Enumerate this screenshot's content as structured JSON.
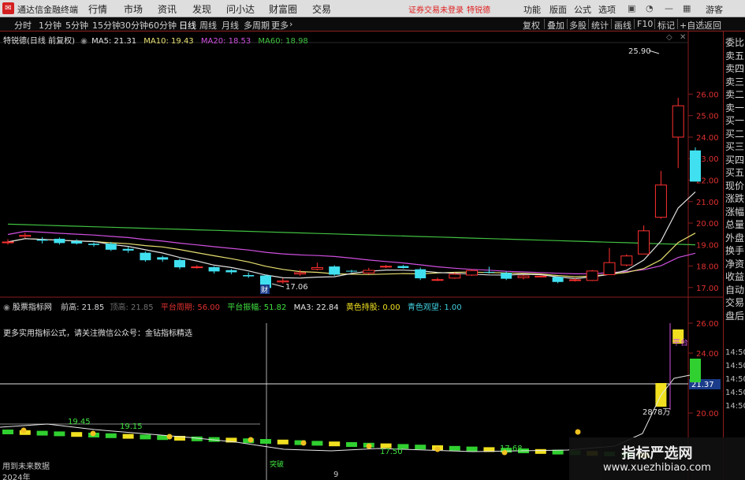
{
  "app": {
    "title": "通达信金融终端"
  },
  "menu": [
    "行情",
    "市场",
    "资讯",
    "发现",
    "问小达",
    "财富圈",
    "交易"
  ],
  "login_warning": "证券交易未登录",
  "stock_link": "特锐德",
  "menu_right": [
    "功能",
    "版面",
    "公式",
    "选项"
  ],
  "guest": "游客",
  "periods": [
    "分时",
    "1分钟",
    "5分钟",
    "15分钟",
    "30分钟",
    "60分钟",
    "日线",
    "周线",
    "月线",
    "多周期",
    "更多"
  ],
  "active_period": "日线",
  "toolbar": [
    "复权",
    "叠加",
    "多股",
    "统计",
    "画线",
    "F10",
    "标记",
    "+自选",
    "返回"
  ],
  "main": {
    "header": "特锐德(日线 前复权)",
    "ma": [
      {
        "label": "MA5: 21.31",
        "color": "#e0e0e0"
      },
      {
        "label": "MA10: 19.43",
        "color": "#e8e070"
      },
      {
        "label": "MA20: 18.53",
        "color": "#d050e0"
      },
      {
        "label": "MA60: 18.98",
        "color": "#40c040"
      }
    ],
    "high_label": "25.90",
    "low_label": "17.06",
    "event_label": "财",
    "price_axis": [
      "26.00",
      "25.00",
      "24.00",
      "23.00",
      "22.00",
      "21.00",
      "20.00",
      "19.00",
      "18.00",
      "17.00"
    ]
  },
  "sub": {
    "header_name": "股票指标网",
    "values": [
      {
        "label": "前高: 21.85",
        "color": "#d8d8d8"
      },
      {
        "label": "顶高: 21.85",
        "color": "#707070"
      },
      {
        "label": "平台周期: 56.00",
        "color": "#e03030"
      },
      {
        "label": "平台振幅: 51.82",
        "color": "#40e040"
      },
      {
        "label": "MA3: 22.84",
        "color": "#e8e8e8"
      },
      {
        "label": "黄色持股: 0.00",
        "color": "#f0e020"
      },
      {
        "label": "青色观望: 1.00",
        "color": "#40d0e0"
      }
    ],
    "promo": "更多实用指标公式，请关注微信公众号：金钻指标精选",
    "axis": [
      "26.00",
      "24.00",
      "21.37",
      "20.00"
    ],
    "ref_value": "21.37",
    "labels": [
      "19.45",
      "19.15",
      "17.50",
      "17.68",
      "2878万",
      "平台",
      "突破"
    ],
    "footer_left": "用到未来数据",
    "date_left": "2024年",
    "date_mid": "9"
  },
  "right_panel": [
    "委比",
    "卖五",
    "卖四",
    "卖三",
    "卖二",
    "卖一",
    "买一",
    "买二",
    "买三",
    "买四",
    "买五",
    "现价",
    "涨跌",
    "涨幅",
    "总量",
    "外盘",
    "换手",
    "净资",
    "收益",
    "自动",
    "交易",
    "盘后"
  ],
  "time_axis": [
    "14:50",
    "14:50",
    "14:50",
    "14:50",
    "14:50"
  ],
  "watermark": {
    "title": "指标严选网",
    "url": "www.xuezhibiao.com"
  },
  "colors": {
    "up": "#ff3030",
    "down": "#40e0f0",
    "ma5": "#e0e0e0",
    "ma10": "#e8e070",
    "ma20": "#d050e0",
    "ma60": "#40c040",
    "accent": "#8a1c1c"
  },
  "chart_data": {
    "type": "candlestick",
    "ylim": [
      16.7,
      28.4
    ],
    "candles": [
      [
        19.12,
        19.12,
        19.25,
        19.0
      ],
      [
        19.38,
        19.43,
        19.55,
        19.3
      ],
      [
        19.23,
        19.18,
        19.35,
        19.05
      ],
      [
        19.27,
        19.07,
        19.33,
        19.0
      ],
      [
        19.16,
        19.05,
        19.25,
        19.0
      ],
      [
        19.04,
        18.98,
        19.1,
        18.9
      ],
      [
        19.04,
        18.76,
        19.12,
        18.7
      ],
      [
        18.8,
        18.72,
        18.9,
        18.62
      ],
      [
        18.62,
        18.27,
        18.68,
        18.2
      ],
      [
        18.41,
        18.3,
        18.48,
        18.2
      ],
      [
        18.28,
        17.94,
        18.35,
        17.85
      ],
      [
        17.96,
        17.96,
        18.04,
        17.88
      ],
      [
        17.95,
        17.75,
        17.99,
        17.65
      ],
      [
        17.81,
        17.71,
        17.86,
        17.62
      ],
      [
        17.58,
        17.52,
        17.7,
        17.45
      ],
      [
        17.56,
        16.98,
        17.6,
        16.9
      ],
      [
        17.26,
        17.31,
        17.44,
        17.18
      ],
      [
        17.63,
        17.69,
        17.83,
        17.55
      ],
      [
        17.85,
        17.93,
        18.16,
        17.8
      ],
      [
        17.98,
        17.6,
        18.04,
        17.55
      ],
      [
        17.78,
        17.76,
        17.83,
        17.7
      ],
      [
        17.68,
        17.8,
        17.92,
        17.62
      ],
      [
        17.96,
        17.99,
        18.05,
        17.9
      ],
      [
        18.0,
        17.91,
        18.05,
        17.88
      ],
      [
        17.85,
        17.43,
        17.93,
        17.35
      ],
      [
        17.35,
        17.37,
        17.46,
        17.3
      ],
      [
        17.44,
        17.62,
        17.7,
        17.4
      ],
      [
        17.58,
        17.79,
        17.86,
        17.54
      ],
      [
        17.73,
        17.72,
        17.97,
        17.65
      ],
      [
        17.68,
        17.41,
        17.75,
        17.35
      ],
      [
        17.46,
        17.54,
        17.58,
        17.38
      ],
      [
        17.53,
        17.53,
        17.57,
        17.47
      ],
      [
        17.49,
        17.26,
        17.53,
        17.2
      ],
      [
        17.34,
        17.36,
        17.44,
        17.28
      ],
      [
        17.33,
        17.77,
        17.82,
        17.3
      ],
      [
        17.6,
        18.16,
        18.84,
        17.6
      ],
      [
        18.05,
        18.47,
        18.55,
        17.98
      ],
      [
        18.56,
        19.64,
        19.89,
        18.56
      ],
      [
        20.27,
        21.77,
        22.43,
        20.2
      ],
      [
        24.0,
        25.46,
        25.83,
        22.56
      ],
      [
        23.38,
        21.93,
        23.52,
        21.93
      ]
    ]
  }
}
